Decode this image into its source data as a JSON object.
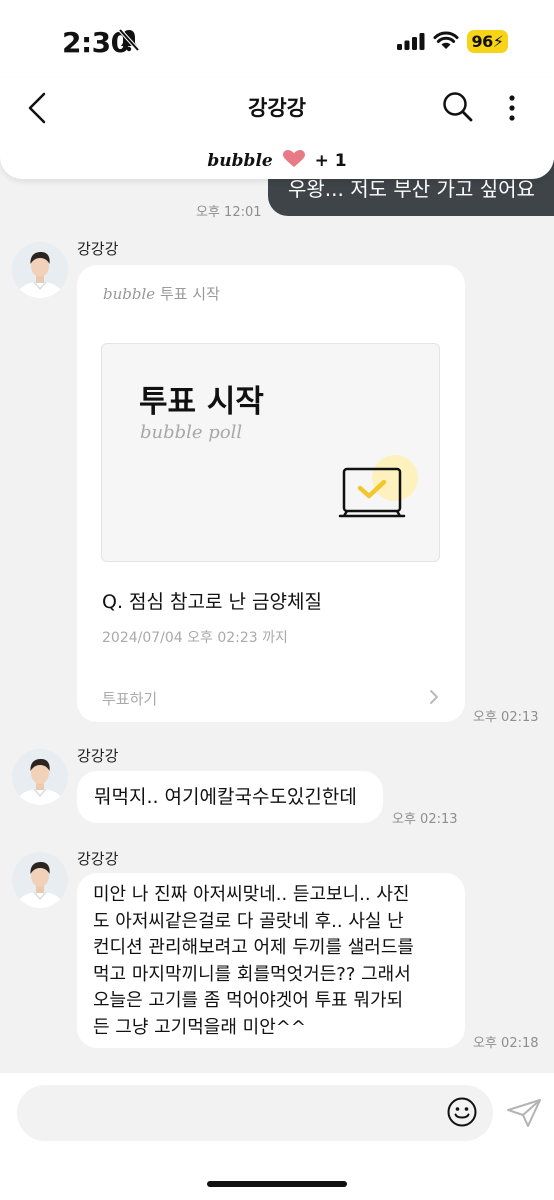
{
  "status_bar": {
    "time": "2:30",
    "battery": "96"
  },
  "header": {
    "title": "강강강",
    "brand": "bubble",
    "count": "+ 1"
  },
  "messages": {
    "my_message": {
      "text": "우왕... 저도 부산 가고 싶어요",
      "time": "오후 12:01"
    },
    "poll": {
      "sender": "강강강",
      "head_brand": "bubble",
      "head_label": "투표 시작",
      "card_title": "투표 시작",
      "card_subtitle": "bubble poll",
      "question": "Q. 점심 참고로 난 금양체질",
      "deadline": "2024/07/04 오후 02:23 까지",
      "action": "투표하기",
      "time": "오후 02:13"
    },
    "msg2": {
      "sender": "강강강",
      "text": "뭐먹지.. 여기에칼국수도있긴한데",
      "time": "오후 02:13"
    },
    "msg3": {
      "sender": "강강강",
      "lines": [
        "미안 나 진짜 아저씨맞네.. 듣고보니.. 사진",
        "도 아저씨같은걸로 다 골랏네 후.. 사실 난",
        "컨디션 관리해보려고 어제 두끼를 샐러드를",
        "먹고 마지막끼니를 회를먹엇거든?? 그래서",
        "오늘은 고기를 좀 먹어야겟어 투표 뭐가되",
        "든 그냥 고기먹을래 미안^^"
      ],
      "time": "오후 02:18"
    }
  },
  "composer": {
    "placeholder": ""
  },
  "colors": {
    "background": "#f2f2f2",
    "my_bubble": "#3f4449",
    "battery": "#f7d417",
    "heart": "#e87a86",
    "check": "#f2c62e"
  },
  "icons": [
    "bell-slash-icon",
    "signal-icon",
    "wifi-icon",
    "back-icon",
    "search-icon",
    "more-icon",
    "heart-icon",
    "chevron-right-icon",
    "emoji-icon",
    "send-icon"
  ]
}
